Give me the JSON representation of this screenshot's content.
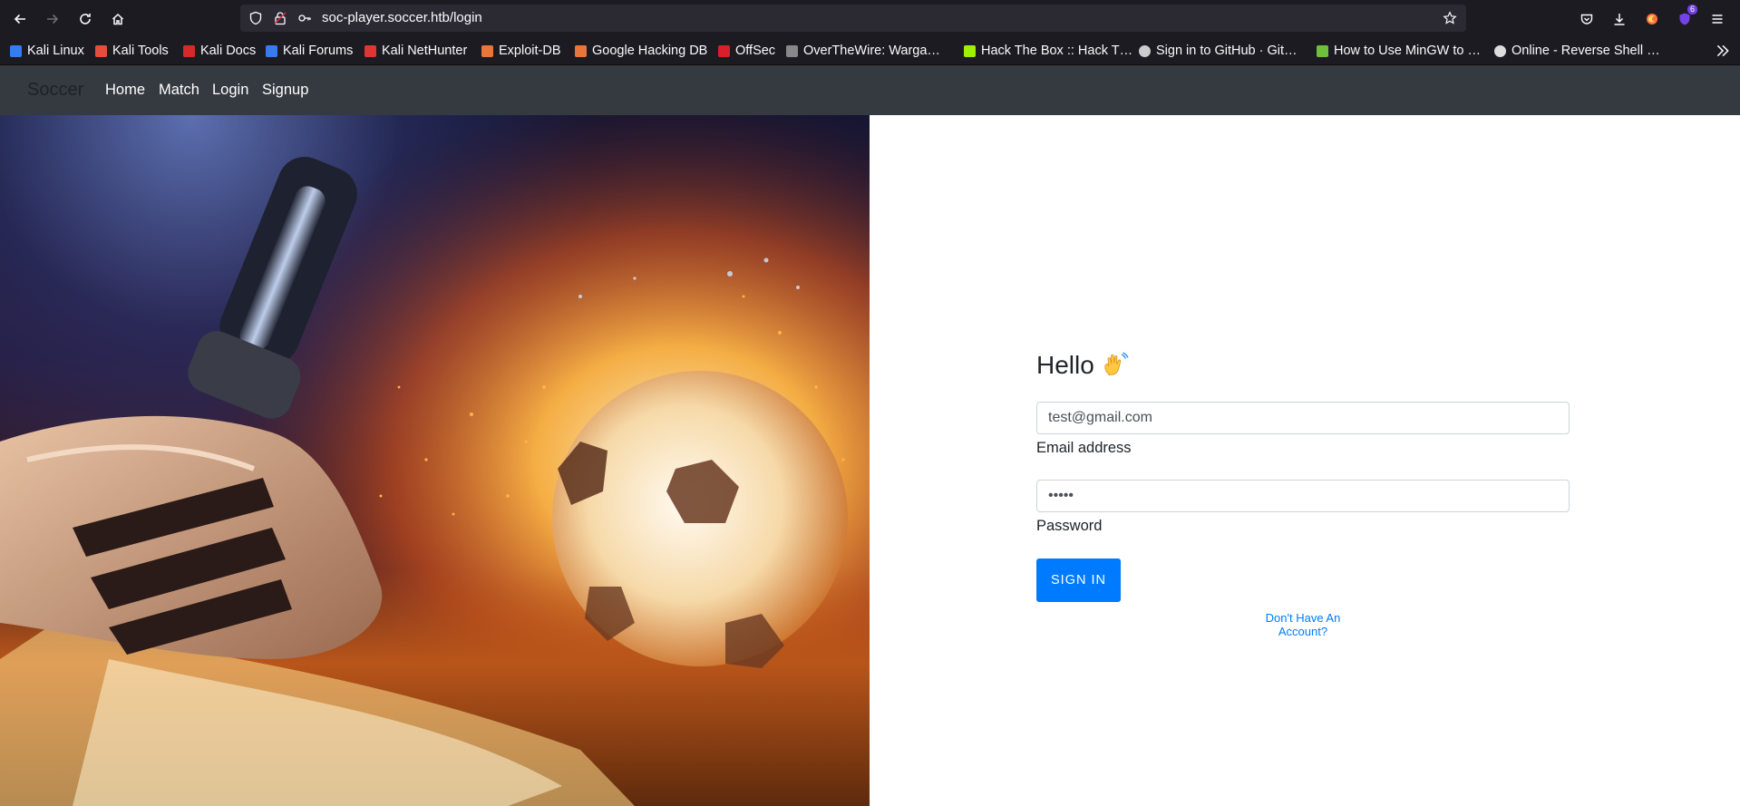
{
  "browser": {
    "url": "soc-player.soccer.htb/login",
    "extensions_badge": "6"
  },
  "bookmarks": [
    {
      "label": "Kali Linux",
      "color": "#367bf0"
    },
    {
      "label": "Kali Tools",
      "color": "#e84c3d"
    },
    {
      "label": "Kali Docs",
      "color": "#d62a2a"
    },
    {
      "label": "Kali Forums",
      "color": "#367bf0"
    },
    {
      "label": "Kali NetHunter",
      "color": "#e03535"
    },
    {
      "label": "Exploit-DB",
      "color": "#e8763a"
    },
    {
      "label": "Google Hacking DB",
      "color": "#e8763a"
    },
    {
      "label": "OffSec",
      "color": "#d91f2a"
    },
    {
      "label": "OverTheWire: Warga…",
      "color": "#888888"
    },
    {
      "label": "Hack The Box :: Hack T…",
      "color": "#9fef00"
    },
    {
      "label": "Sign in to GitHub · Git…",
      "color": "#cccccc"
    },
    {
      "label": "How to Use MinGW to …",
      "color": "#6fbf3c"
    },
    {
      "label": "Online - Reverse Shell …",
      "color": "#dddddd"
    }
  ],
  "site": {
    "brand": "Soccer",
    "nav": [
      "Home",
      "Match",
      "Login",
      "Signup"
    ]
  },
  "login": {
    "greeting": "Hello",
    "email_value": "test@gmail.com",
    "email_label": "Email address",
    "password_value": "abcde",
    "password_label": "Password",
    "submit_label": "SIGN IN",
    "create_account_link": "Don't Have An Account?"
  },
  "colors": {
    "primary": "#007bff",
    "navbar": "#343a40",
    "browser_chrome": "#1c1b22"
  }
}
